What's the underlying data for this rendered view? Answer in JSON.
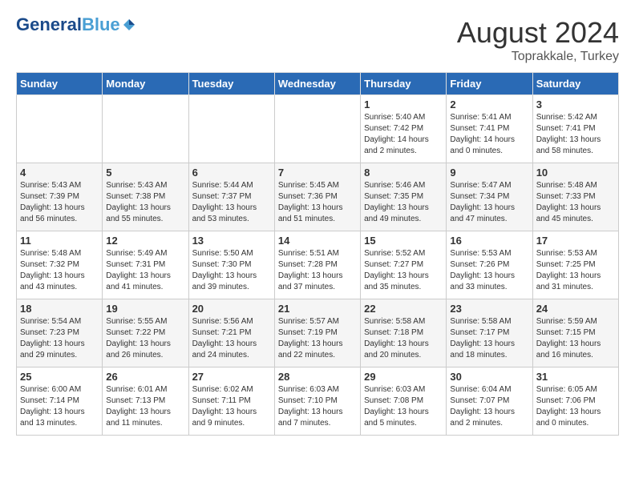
{
  "header": {
    "logo_general": "General",
    "logo_blue": "Blue",
    "title": "August 2024",
    "location": "Toprakkale, Turkey"
  },
  "calendar": {
    "days_of_week": [
      "Sunday",
      "Monday",
      "Tuesday",
      "Wednesday",
      "Thursday",
      "Friday",
      "Saturday"
    ],
    "weeks": [
      [
        {
          "day": "",
          "content": ""
        },
        {
          "day": "",
          "content": ""
        },
        {
          "day": "",
          "content": ""
        },
        {
          "day": "",
          "content": ""
        },
        {
          "day": "1",
          "content": "Sunrise: 5:40 AM\nSunset: 7:42 PM\nDaylight: 14 hours\nand 2 minutes."
        },
        {
          "day": "2",
          "content": "Sunrise: 5:41 AM\nSunset: 7:41 PM\nDaylight: 14 hours\nand 0 minutes."
        },
        {
          "day": "3",
          "content": "Sunrise: 5:42 AM\nSunset: 7:41 PM\nDaylight: 13 hours\nand 58 minutes."
        }
      ],
      [
        {
          "day": "4",
          "content": "Sunrise: 5:43 AM\nSunset: 7:39 PM\nDaylight: 13 hours\nand 56 minutes."
        },
        {
          "day": "5",
          "content": "Sunrise: 5:43 AM\nSunset: 7:38 PM\nDaylight: 13 hours\nand 55 minutes."
        },
        {
          "day": "6",
          "content": "Sunrise: 5:44 AM\nSunset: 7:37 PM\nDaylight: 13 hours\nand 53 minutes."
        },
        {
          "day": "7",
          "content": "Sunrise: 5:45 AM\nSunset: 7:36 PM\nDaylight: 13 hours\nand 51 minutes."
        },
        {
          "day": "8",
          "content": "Sunrise: 5:46 AM\nSunset: 7:35 PM\nDaylight: 13 hours\nand 49 minutes."
        },
        {
          "day": "9",
          "content": "Sunrise: 5:47 AM\nSunset: 7:34 PM\nDaylight: 13 hours\nand 47 minutes."
        },
        {
          "day": "10",
          "content": "Sunrise: 5:48 AM\nSunset: 7:33 PM\nDaylight: 13 hours\nand 45 minutes."
        }
      ],
      [
        {
          "day": "11",
          "content": "Sunrise: 5:48 AM\nSunset: 7:32 PM\nDaylight: 13 hours\nand 43 minutes."
        },
        {
          "day": "12",
          "content": "Sunrise: 5:49 AM\nSunset: 7:31 PM\nDaylight: 13 hours\nand 41 minutes."
        },
        {
          "day": "13",
          "content": "Sunrise: 5:50 AM\nSunset: 7:30 PM\nDaylight: 13 hours\nand 39 minutes."
        },
        {
          "day": "14",
          "content": "Sunrise: 5:51 AM\nSunset: 7:28 PM\nDaylight: 13 hours\nand 37 minutes."
        },
        {
          "day": "15",
          "content": "Sunrise: 5:52 AM\nSunset: 7:27 PM\nDaylight: 13 hours\nand 35 minutes."
        },
        {
          "day": "16",
          "content": "Sunrise: 5:53 AM\nSunset: 7:26 PM\nDaylight: 13 hours\nand 33 minutes."
        },
        {
          "day": "17",
          "content": "Sunrise: 5:53 AM\nSunset: 7:25 PM\nDaylight: 13 hours\nand 31 minutes."
        }
      ],
      [
        {
          "day": "18",
          "content": "Sunrise: 5:54 AM\nSunset: 7:23 PM\nDaylight: 13 hours\nand 29 minutes."
        },
        {
          "day": "19",
          "content": "Sunrise: 5:55 AM\nSunset: 7:22 PM\nDaylight: 13 hours\nand 26 minutes."
        },
        {
          "day": "20",
          "content": "Sunrise: 5:56 AM\nSunset: 7:21 PM\nDaylight: 13 hours\nand 24 minutes."
        },
        {
          "day": "21",
          "content": "Sunrise: 5:57 AM\nSunset: 7:19 PM\nDaylight: 13 hours\nand 22 minutes."
        },
        {
          "day": "22",
          "content": "Sunrise: 5:58 AM\nSunset: 7:18 PM\nDaylight: 13 hours\nand 20 minutes."
        },
        {
          "day": "23",
          "content": "Sunrise: 5:58 AM\nSunset: 7:17 PM\nDaylight: 13 hours\nand 18 minutes."
        },
        {
          "day": "24",
          "content": "Sunrise: 5:59 AM\nSunset: 7:15 PM\nDaylight: 13 hours\nand 16 minutes."
        }
      ],
      [
        {
          "day": "25",
          "content": "Sunrise: 6:00 AM\nSunset: 7:14 PM\nDaylight: 13 hours\nand 13 minutes."
        },
        {
          "day": "26",
          "content": "Sunrise: 6:01 AM\nSunset: 7:13 PM\nDaylight: 13 hours\nand 11 minutes."
        },
        {
          "day": "27",
          "content": "Sunrise: 6:02 AM\nSunset: 7:11 PM\nDaylight: 13 hours\nand 9 minutes."
        },
        {
          "day": "28",
          "content": "Sunrise: 6:03 AM\nSunset: 7:10 PM\nDaylight: 13 hours\nand 7 minutes."
        },
        {
          "day": "29",
          "content": "Sunrise: 6:03 AM\nSunset: 7:08 PM\nDaylight: 13 hours\nand 5 minutes."
        },
        {
          "day": "30",
          "content": "Sunrise: 6:04 AM\nSunset: 7:07 PM\nDaylight: 13 hours\nand 2 minutes."
        },
        {
          "day": "31",
          "content": "Sunrise: 6:05 AM\nSunset: 7:06 PM\nDaylight: 13 hours\nand 0 minutes."
        }
      ]
    ]
  }
}
